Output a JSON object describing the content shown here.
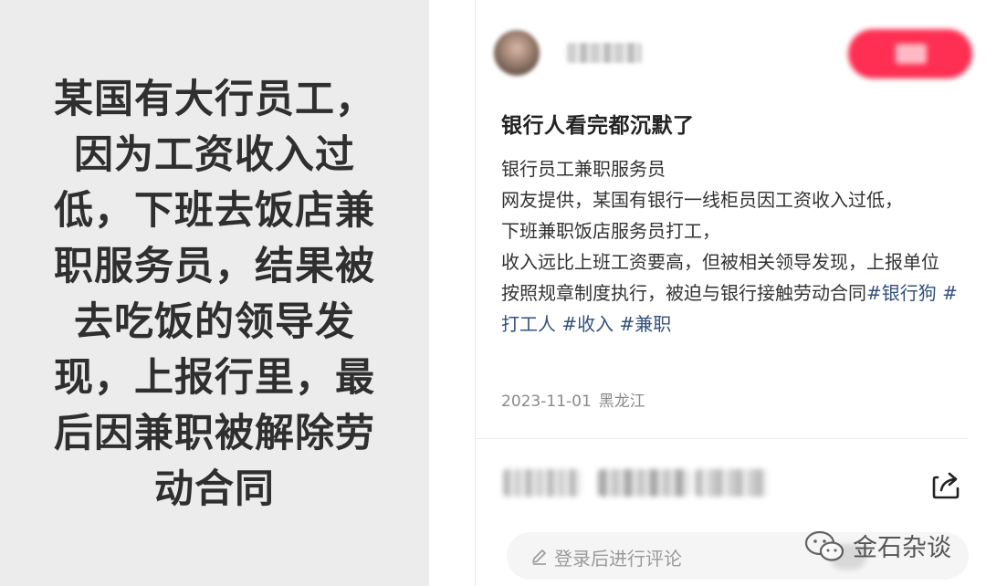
{
  "poster": {
    "text": "某国有大行员工，\n因为工资收入过\n低，下班去饭店兼\n职服务员，结果被\n去吃饭的领导发\n现，上报行里，最\n后因兼职被解除劳\n动合同"
  },
  "note": {
    "title": "银行人看完都沉默了",
    "body": {
      "line1": "银行员工兼职服务员",
      "line2": "网友提供，某国有银行一线柜员因工资收入过低，",
      "line3": "下班兼职饭店服务员打工，",
      "line4": "收入远比上班工资要高，但被相关领导发现，上报单位",
      "line5": "按照规章制度执行，被迫与银行接触劳动合同"
    },
    "tags": [
      "#银行狗",
      "#打工人",
      "#收入",
      "#兼职"
    ],
    "date": "2023-11-01",
    "location": "黑龙江"
  },
  "comment": {
    "placeholder": "登录后进行评论"
  },
  "watermark": {
    "text": "金石杂谈"
  },
  "colors": {
    "accent": "#fe2f52",
    "tag": "#34517d",
    "poster_bg": "#ececec"
  }
}
